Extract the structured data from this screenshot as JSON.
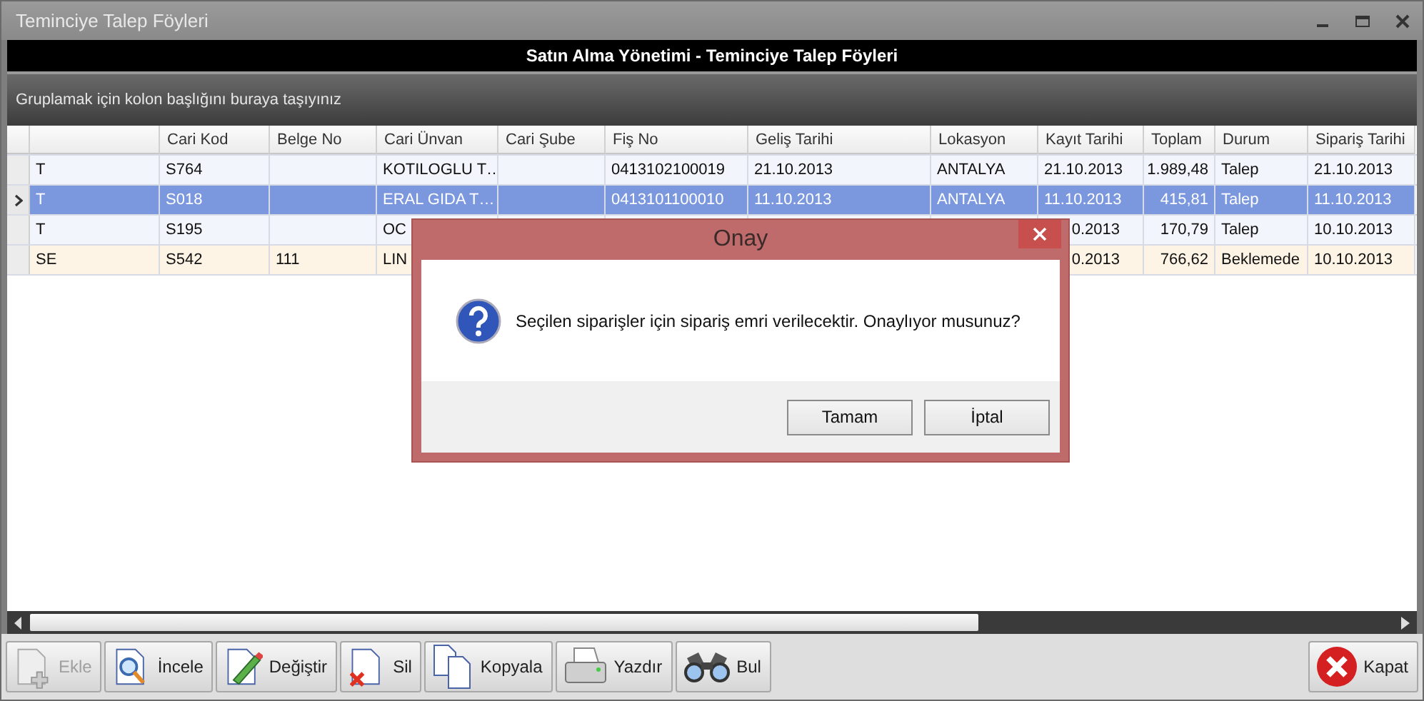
{
  "window": {
    "title": "Teminciye Talep Föyleri"
  },
  "header": {
    "title": "Satın Alma Yönetimi - Teminciye Talep Föyleri"
  },
  "group_panel": {
    "hint": "Gruplamak için kolon başlığını buraya taşıyınız"
  },
  "table": {
    "columns": [
      {},
      {
        "label": "Cari Kod"
      },
      {
        "label": "Belge No"
      },
      {
        "label": "Cari Ünvan"
      },
      {
        "label": "Cari Şube"
      },
      {
        "label": "Fiş No"
      },
      {
        "label": "Geliş Tarihi"
      },
      {
        "label": "Lokasyon"
      },
      {
        "label": "Kayıt Tarihi"
      },
      {
        "label": "Toplam",
        "kind": "number"
      },
      {
        "label": "Durum"
      },
      {
        "label": "Sipariş Tarihi"
      }
    ],
    "rows": [
      {
        "selected": false,
        "highlight": false,
        "cells": [
          "T",
          "S764",
          null,
          "KOTILOGLU T…",
          null,
          "0413102100019",
          "21.10.2013",
          "ANTALYA",
          "21.10.2013",
          "1.989,48",
          "Talep",
          "21.10.2013"
        ]
      },
      {
        "selected": true,
        "cells": [
          "T",
          "S018",
          null,
          "ERAL GIDA T…",
          null,
          "0413101100010",
          "11.10.2013",
          "ANTALYA",
          "11.10.2013",
          "415,81",
          "Talep",
          "11.10.2013"
        ]
      },
      {
        "selected": false,
        "highlight": false,
        "cells": [
          "T",
          "S195",
          null,
          "OC",
          null,
          null,
          null,
          null,
          {
            "tail": "0.2013"
          },
          "170,79",
          "Talep",
          "10.10.2013"
        ]
      },
      {
        "selected": false,
        "highlight": true,
        "cells": [
          "SE",
          "S542",
          "111",
          "LIN",
          null,
          null,
          null,
          null,
          {
            "tail": "0.2013"
          },
          "766,62",
          "Beklemede",
          "10.10.2013"
        ]
      }
    ]
  },
  "toolbar": [
    {
      "kind": "new",
      "label": "Ekle",
      "disabled": true
    },
    {
      "kind": "view",
      "label": "İncele",
      "disabled": false
    },
    {
      "kind": "edit",
      "label": "Değiştir",
      "disabled": false
    },
    {
      "kind": "delete",
      "label": "Sil",
      "disabled": false
    },
    {
      "kind": "copy",
      "label": "Kopyala",
      "disabled": false
    },
    {
      "kind": "print",
      "label": "Yazdır",
      "disabled": false
    },
    {
      "kind": "find",
      "label": "Bul",
      "disabled": false
    }
  ],
  "close_button": {
    "label": "Kapat"
  },
  "dialog": {
    "title": "Onay",
    "message": "Seçilen siparişler için sipariş emri verilecektir. Onaylıyor musunuz?",
    "buttons": [
      "Tamam",
      "İptal"
    ]
  }
}
